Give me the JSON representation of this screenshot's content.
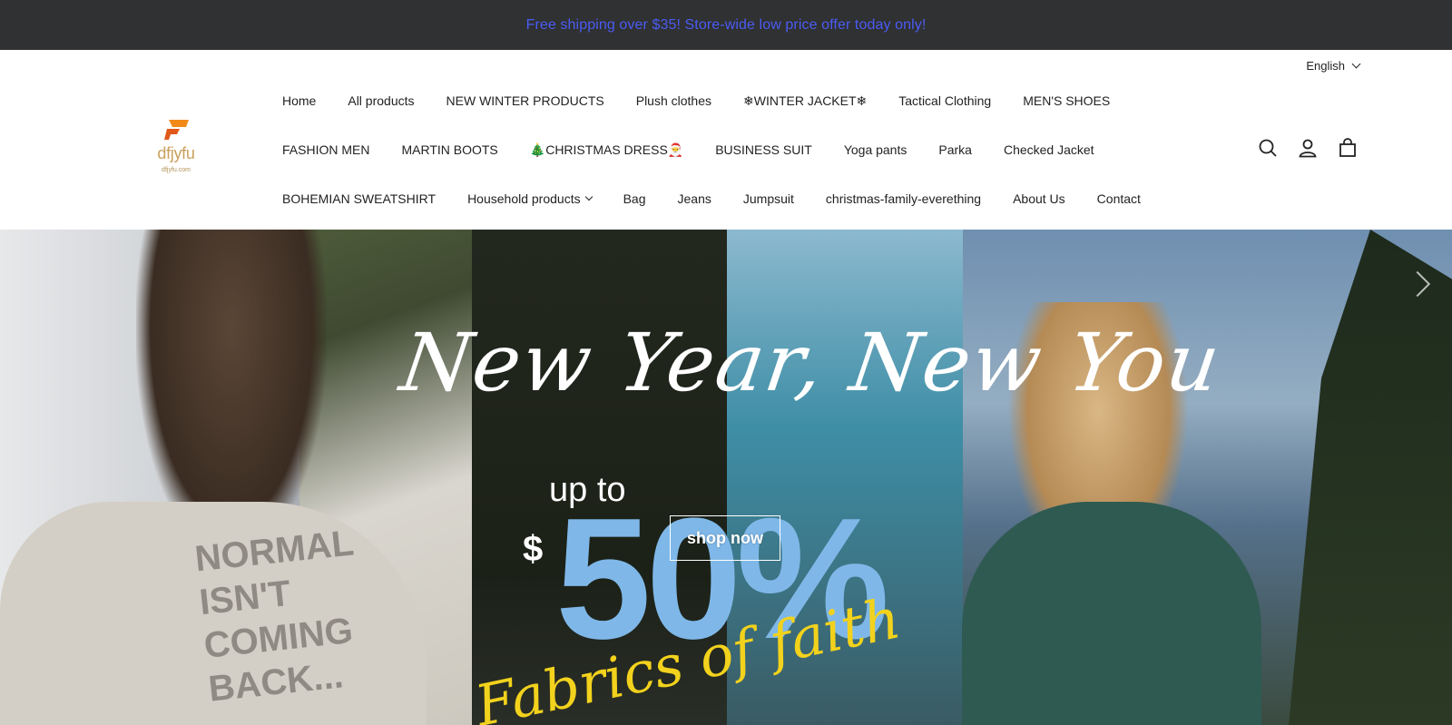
{
  "announcement": {
    "text": "Free shipping over $35!  Store-wide low price offer today only!"
  },
  "language": {
    "label": "English"
  },
  "logo": {
    "brand": "dfjyfu",
    "sub": "dfjyfu.com"
  },
  "nav": {
    "row1": [
      "Home",
      "All products",
      "NEW WINTER PRODUCTS",
      "Plush clothes",
      "❄WINTER JACKET❄",
      "Tactical Clothing",
      "MEN'S SHOES"
    ],
    "row2": [
      "FASHION MEN",
      "MARTIN BOOTS",
      "🎄CHRISTMAS DRESS🎅",
      "BUSINESS SUIT",
      "Yoga pants",
      "Parka",
      "Checked Jacket"
    ],
    "row3": [
      "BOHEMIAN SWEATSHIRT",
      "Household products",
      "Bag",
      "Jeans",
      "Jumpsuit",
      "christmas-family-everething",
      "About Us",
      "Contact"
    ]
  },
  "header_icons": [
    "search-icon",
    "account-icon",
    "cart-icon"
  ],
  "hero": {
    "headline": "New Year, New You",
    "upto": "up to",
    "currency": "$",
    "discount": "50%",
    "tagline": "Fabrics of faith",
    "shirt_text": [
      "NORMAL",
      "ISN'T",
      "COMING",
      "BACK..."
    ],
    "cta": "shop now"
  },
  "colors": {
    "announcement_bg": "#303132",
    "announcement_text": "#4a5cf4",
    "logo_gold": "#c9a05c",
    "logo_orange": "#f28a1a"
  }
}
